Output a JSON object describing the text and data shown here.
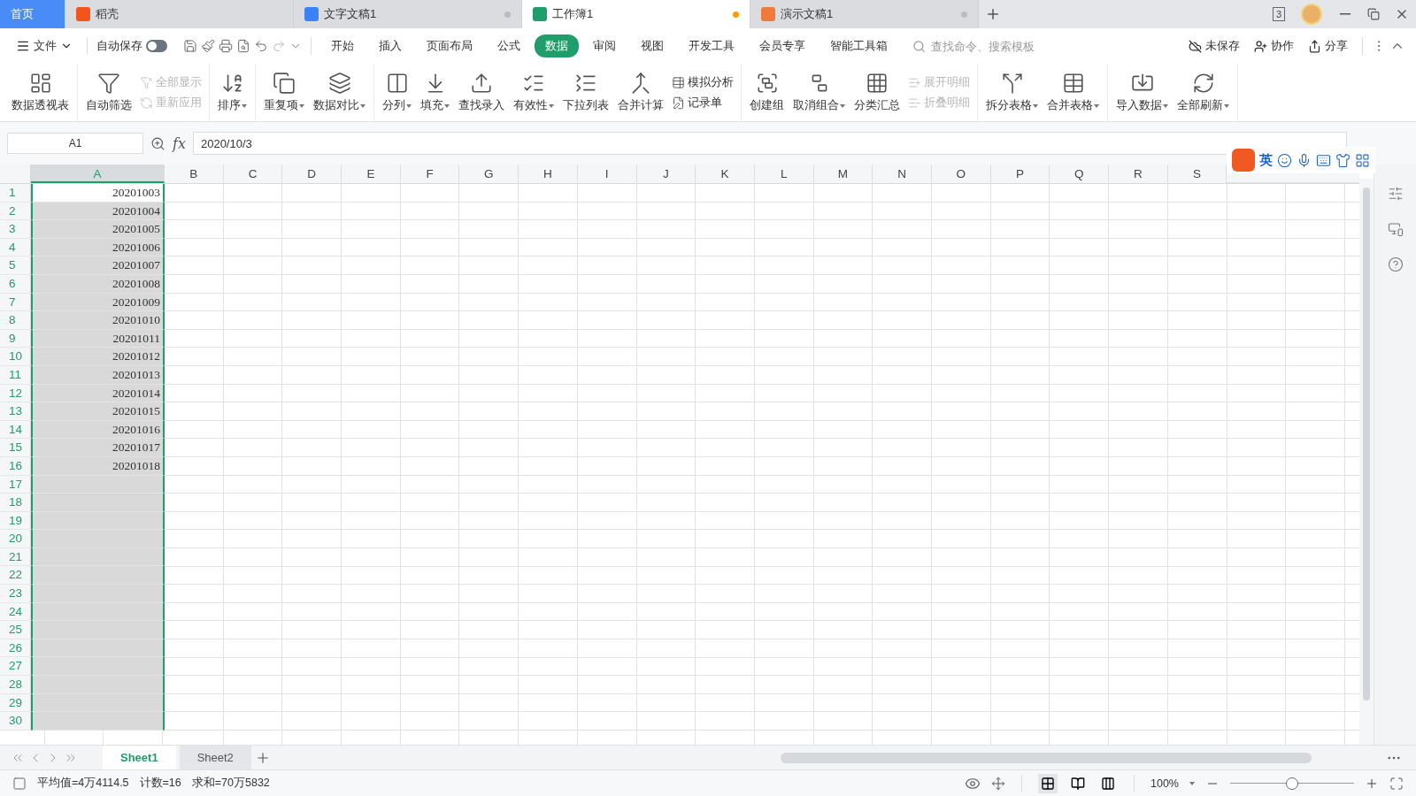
{
  "doc_tabs": [
    {
      "label": "首页",
      "kind": "home",
      "selected": false
    },
    {
      "label": "稻壳",
      "kind": "app",
      "color": "#f2541b",
      "selected": false
    },
    {
      "label": "文字文稿1",
      "kind": "app",
      "color": "#3b82f6",
      "selected": false,
      "unsaved": false
    },
    {
      "label": "工作簿1",
      "kind": "app",
      "color": "#1f9d6b",
      "selected": true,
      "unsaved": true
    },
    {
      "label": "演示文稿1",
      "kind": "app",
      "color": "#f07a3c",
      "selected": false,
      "unsaved": false
    }
  ],
  "window_count": "3",
  "menu": {
    "file": "文件",
    "autosave": {
      "label": "自动保存",
      "on": false
    },
    "tabs": [
      {
        "label": "开始",
        "selected": false
      },
      {
        "label": "插入",
        "selected": false
      },
      {
        "label": "页面布局",
        "selected": false
      },
      {
        "label": "公式",
        "selected": false
      },
      {
        "label": "数据",
        "selected": true
      },
      {
        "label": "审阅",
        "selected": false
      },
      {
        "label": "视图",
        "selected": false
      },
      {
        "label": "开发工具",
        "selected": false
      },
      {
        "label": "会员专享",
        "selected": false
      },
      {
        "label": "智能工具箱",
        "selected": false
      }
    ],
    "search": {
      "placeholder": "查找命令、搜索模板"
    },
    "actions": [
      "未保存",
      "协作",
      "分享"
    ]
  },
  "ribbon": [
    [
      {
        "kind": "large",
        "label": "数据透视表",
        "dropdown": false
      }
    ],
    [
      {
        "kind": "large",
        "label": "自动筛选",
        "dropdown": false
      },
      {
        "kind": "stack",
        "items": [
          {
            "label": "全部显示",
            "disabled": true
          },
          {
            "label": "重新应用",
            "disabled": true
          }
        ]
      }
    ],
    [
      {
        "kind": "large",
        "label": "排序",
        "dropdown": true
      }
    ],
    [
      {
        "kind": "large",
        "label": "重复项",
        "dropdown": true
      },
      {
        "kind": "large",
        "label": "数据对比",
        "dropdown": true
      }
    ],
    [
      {
        "kind": "large",
        "label": "分列",
        "dropdown": true
      },
      {
        "kind": "large",
        "label": "填充",
        "dropdown": true
      },
      {
        "kind": "large",
        "label": "查找录入",
        "dropdown": false
      },
      {
        "kind": "large",
        "label": "有效性",
        "dropdown": true
      },
      {
        "kind": "large",
        "label": "下拉列表",
        "dropdown": false
      },
      {
        "kind": "large",
        "label": "合并计算",
        "dropdown": false
      },
      {
        "kind": "stack",
        "items": [
          {
            "label": "模拟分析",
            "disabled": false
          },
          {
            "label": "记录单",
            "disabled": false
          }
        ]
      }
    ],
    [
      {
        "kind": "large",
        "label": "创建组",
        "dropdown": false
      },
      {
        "kind": "large",
        "label": "取消组合",
        "dropdown": true
      },
      {
        "kind": "large",
        "label": "分类汇总",
        "dropdown": false
      },
      {
        "kind": "stack",
        "items": [
          {
            "label": "展开明细",
            "disabled": true
          },
          {
            "label": "折叠明细",
            "disabled": true
          }
        ]
      }
    ],
    [
      {
        "kind": "large",
        "label": "拆分表格",
        "dropdown": true
      },
      {
        "kind": "large",
        "label": "合并表格",
        "dropdown": true
      }
    ],
    [
      {
        "kind": "large",
        "label": "导入数据",
        "dropdown": true
      },
      {
        "kind": "large",
        "label": "全部刷新",
        "dropdown": true
      }
    ]
  ],
  "formula_bar": {
    "name_box": "A1",
    "fx": "fx",
    "value": "2020/10/3"
  },
  "ime_toolbar": {
    "mode": "英"
  },
  "sheet": {
    "columns": [
      {
        "label": "A",
        "selected": true
      },
      {
        "label": "B",
        "selected": false
      },
      {
        "label": "C",
        "selected": false
      },
      {
        "label": "D",
        "selected": false
      },
      {
        "label": "E",
        "selected": false
      },
      {
        "label": "F",
        "selected": false
      },
      {
        "label": "G",
        "selected": false
      },
      {
        "label": "H",
        "selected": false
      },
      {
        "label": "I",
        "selected": false
      },
      {
        "label": "J",
        "selected": false
      },
      {
        "label": "K",
        "selected": false
      },
      {
        "label": "L",
        "selected": false
      },
      {
        "label": "M",
        "selected": false
      },
      {
        "label": "N",
        "selected": false
      },
      {
        "label": "O",
        "selected": false
      },
      {
        "label": "P",
        "selected": false
      },
      {
        "label": "Q",
        "selected": false
      },
      {
        "label": "R",
        "selected": false
      },
      {
        "label": "S",
        "selected": false
      }
    ],
    "rows": [
      {
        "number": "1",
        "cells": [
          "20201003"
        ],
        "active": true
      },
      {
        "number": "2",
        "cells": [
          "20201004"
        ],
        "active": false
      },
      {
        "number": "3",
        "cells": [
          "20201005"
        ],
        "active": false
      },
      {
        "number": "4",
        "cells": [
          "20201006"
        ],
        "active": false
      },
      {
        "number": "5",
        "cells": [
          "20201007"
        ],
        "active": false
      },
      {
        "number": "6",
        "cells": [
          "20201008"
        ],
        "active": false
      },
      {
        "number": "7",
        "cells": [
          "20201009"
        ],
        "active": false
      },
      {
        "number": "8",
        "cells": [
          "20201010"
        ],
        "active": false
      },
      {
        "number": "9",
        "cells": [
          "20201011"
        ],
        "active": false
      },
      {
        "number": "10",
        "cells": [
          "20201012"
        ],
        "active": false
      },
      {
        "number": "11",
        "cells": [
          "20201013"
        ],
        "active": false
      },
      {
        "number": "12",
        "cells": [
          "20201014"
        ],
        "active": false
      },
      {
        "number": "13",
        "cells": [
          "20201015"
        ],
        "active": false
      },
      {
        "number": "14",
        "cells": [
          "20201016"
        ],
        "active": false
      },
      {
        "number": "15",
        "cells": [
          "20201017"
        ],
        "active": false
      },
      {
        "number": "16",
        "cells": [
          "20201018"
        ],
        "active": false
      },
      {
        "number": "17",
        "active": false
      },
      {
        "number": "18",
        "active": false
      },
      {
        "number": "19",
        "active": false
      },
      {
        "number": "20",
        "active": false
      },
      {
        "number": "21",
        "active": false
      },
      {
        "number": "22",
        "active": false
      },
      {
        "number": "23",
        "active": false
      },
      {
        "number": "24",
        "active": false
      },
      {
        "number": "25",
        "active": false
      },
      {
        "number": "26",
        "active": false
      },
      {
        "number": "27",
        "active": false
      },
      {
        "number": "28",
        "active": false
      },
      {
        "number": "29",
        "active": false
      },
      {
        "number": "30",
        "active": false
      }
    ]
  },
  "sheet_tabs": [
    {
      "label": "Sheet1",
      "selected": true
    },
    {
      "label": "Sheet2",
      "selected": false
    }
  ],
  "status_bar": {
    "stats": [
      "平均值=4万4114.5",
      "计数=16",
      "求和=70万5832"
    ],
    "zoom": "100%",
    "zoom_slider": {
      "level": 0.5
    }
  }
}
